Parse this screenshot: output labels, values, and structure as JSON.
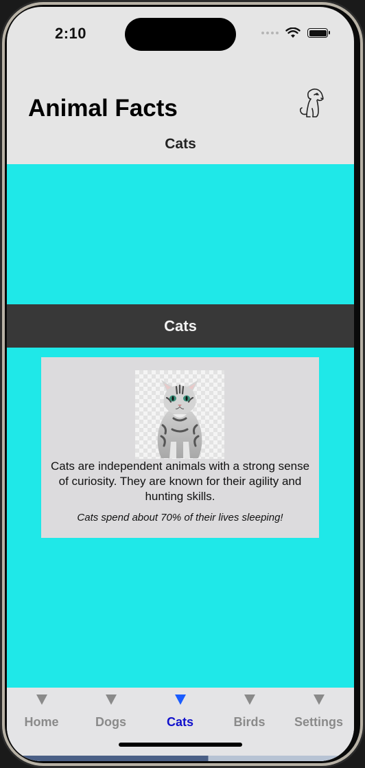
{
  "status_bar": {
    "time": "2:10"
  },
  "header": {
    "title": "Animal Facts",
    "icon": "dog-outline-icon",
    "subtitle": "Cats"
  },
  "content": {
    "background_color": "#1fe8e8",
    "banner_title": "Cats",
    "card": {
      "image": "cat-photo",
      "description": "Cats are independent animals with a strong sense of curiosity. They are known for their agility and hunting skills.",
      "fact": "Cats spend about 70% of their lives sleeping!"
    }
  },
  "tabs": [
    {
      "label": "Home",
      "active": false
    },
    {
      "label": "Dogs",
      "active": false
    },
    {
      "label": "Cats",
      "active": true
    },
    {
      "label": "Birds",
      "active": false
    },
    {
      "label": "Settings",
      "active": false
    }
  ],
  "colors": {
    "accent": "#1010cc",
    "tab_inactive": "#8a8a8a",
    "banner": "#383838"
  }
}
